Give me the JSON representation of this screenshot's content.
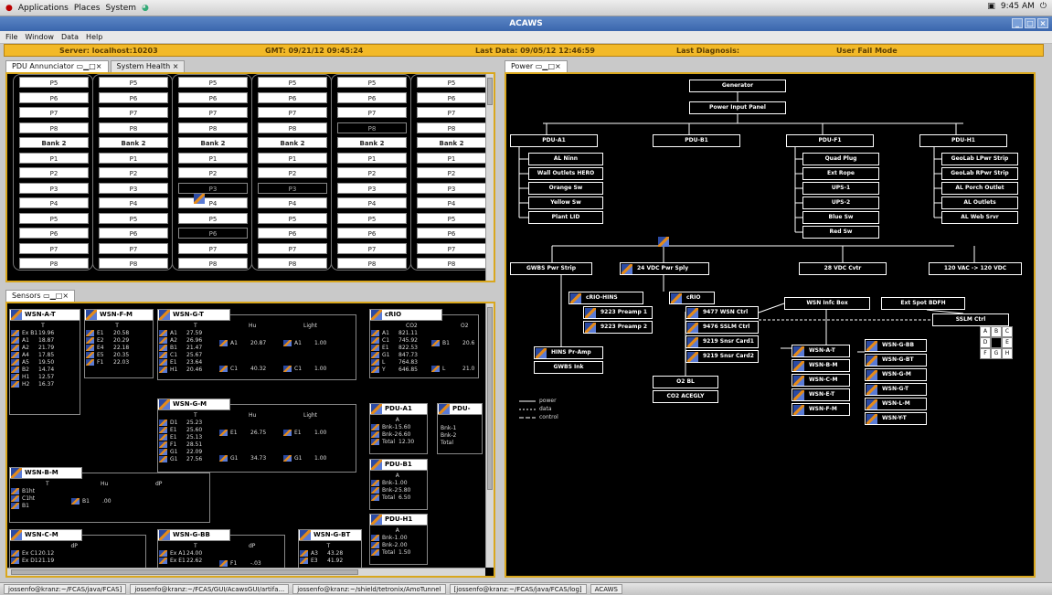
{
  "topbar": {
    "menus": [
      "Applications",
      "Places",
      "System"
    ],
    "time": "9:45 AM"
  },
  "window": {
    "title": "ACAWS"
  },
  "menubar": [
    "File",
    "Window",
    "Data",
    "Help"
  ],
  "status": {
    "server": "Server: localhost:10203",
    "gmt": "GMT: 09/21/12 09:45:24",
    "last_data": "Last Data: 09/05/12 12:46:59",
    "last_diag": "Last Diagnosis:",
    "mode": "User Fail Mode"
  },
  "tabs": {
    "pdu": "PDU Annunciator",
    "health": "System Health",
    "sensors": "Sensors",
    "power": "Power"
  },
  "pdu_columns": [
    [
      "P5",
      "P6",
      "P7",
      "P8",
      "Bank 2",
      "P1",
      "P2",
      "P3",
      "P4",
      "P5",
      "P6",
      "P7",
      "P8"
    ],
    [
      "P5",
      "P6",
      "P7",
      "P8",
      "Bank 2",
      "P1",
      "P2",
      "P3",
      "P4",
      "P5",
      "P6",
      "P7",
      "P8"
    ],
    [
      "P5",
      "P6",
      "P7",
      "P8",
      "Bank 2",
      "P1",
      "P2",
      "P3",
      "P4",
      "P5",
      "P6",
      "P7",
      "P8"
    ],
    [
      "P5",
      "P6",
      "P7",
      "P8",
      "Bank 2",
      "P1",
      "P2",
      "P3",
      "P4",
      "P5",
      "P6",
      "P7",
      "P8"
    ],
    [
      "P5",
      "P6",
      "P7",
      "P8",
      "Bank 2",
      "P1",
      "P2",
      "P3",
      "P4",
      "P5",
      "P6",
      "P7",
      "P8"
    ],
    [
      "P5",
      "P6",
      "P7",
      "P8",
      "Bank 2",
      "P1",
      "P2",
      "P3",
      "P4",
      "P5",
      "P6",
      "P7",
      "P8"
    ]
  ],
  "sensors": {
    "wsn_a_t": {
      "title": "WSN-A-T",
      "col": "T",
      "rows": [
        [
          "Ex B1",
          "19.96"
        ],
        [
          "A1",
          "18.87"
        ],
        [
          "A2",
          "21.79"
        ],
        [
          "A4",
          "17.85"
        ],
        [
          "A5",
          "19.50"
        ],
        [
          "B2",
          "14.74"
        ],
        [
          "H1",
          "12.57"
        ],
        [
          "H2",
          "16.37"
        ]
      ]
    },
    "wsn_f_m": {
      "title": "WSN-F-M",
      "col": "T",
      "rows": [
        [
          "E1",
          "20.58"
        ],
        [
          "E2",
          "20.29"
        ],
        [
          "E4",
          "22.18"
        ],
        [
          "E5",
          "20.35"
        ],
        [
          "F1",
          "22.03"
        ]
      ]
    },
    "wsn_g_t": {
      "title": "WSN-G-T",
      "cols": [
        "T",
        "Hu",
        "Light"
      ],
      "rows": [
        [
          "A1",
          "27.59"
        ],
        [
          "A2",
          "26.96"
        ],
        [
          "B1",
          "21.47"
        ],
        [
          "C1",
          "25.67"
        ],
        [
          "E1",
          "23.64"
        ],
        [
          "H1",
          "20.46"
        ]
      ],
      "hu": [
        [
          "A1",
          "20.87"
        ],
        [
          "C1",
          "40.32"
        ]
      ],
      "light": [
        [
          "A1",
          "1.00"
        ],
        [
          "C1",
          "1.00"
        ]
      ]
    },
    "crio": {
      "title": "cRIO",
      "cols": [
        "CO2",
        "O2"
      ],
      "rows": [
        [
          "A1",
          "821.11"
        ],
        [
          "C1",
          "745.92"
        ],
        [
          "E1",
          "822.53"
        ],
        [
          "G1",
          "847.73"
        ],
        [
          "L",
          "764.83"
        ],
        [
          "Y",
          "646.85"
        ]
      ],
      "o2": [
        [
          "B1",
          "20.6"
        ],
        [
          "L",
          "21.0"
        ]
      ]
    },
    "wsn_g_m": {
      "title": "WSN-G-M",
      "cols": [
        "T",
        "Hu",
        "Light"
      ],
      "rows": [
        [
          "D1",
          "25.23"
        ],
        [
          "E1",
          "25.60"
        ],
        [
          "E1",
          "25.13"
        ],
        [
          "F1",
          "28.51"
        ],
        [
          "G1",
          "22.09"
        ],
        [
          "G1",
          "27.56"
        ]
      ],
      "hu": [
        [
          "E1",
          "26.75"
        ],
        [
          "G1",
          "34.73"
        ]
      ],
      "light": [
        [
          "E1",
          "1.00"
        ],
        [
          "G1",
          "1.00"
        ]
      ]
    },
    "wsn_b_m": {
      "title": "WSN-B-M",
      "cols": [
        "T",
        "Hu",
        "dP"
      ],
      "rows": [
        [
          "B1ht",
          ""
        ],
        [
          "C1ht",
          ""
        ],
        [
          "B1",
          ""
        ]
      ],
      "dp": [
        [
          "B1",
          ".00"
        ]
      ]
    },
    "wsn_c_m": {
      "title": "WSN-C-M",
      "col": "dP",
      "rows": [
        [
          "Ex C1",
          "20.12"
        ],
        [
          "Ex D1",
          "21.19"
        ]
      ]
    },
    "wsn_g_bb": {
      "title": "WSN-G-BB",
      "cols": [
        "T",
        "dP"
      ],
      "rows": [
        [
          "Ex A1",
          "24.00"
        ],
        [
          "Ex E1",
          "22.62"
        ]
      ],
      "dp": [
        [
          "F1",
          "-.03"
        ]
      ]
    },
    "wsn_g_bt": {
      "title": "WSN-G-BT",
      "col": "T",
      "rows": [
        [
          "A3",
          "43.28"
        ],
        [
          "E3",
          "41.92"
        ]
      ]
    },
    "pdu_a1": {
      "title": "PDU-A1",
      "col": "A",
      "rows": [
        [
          "Bnk-1",
          "5.60"
        ],
        [
          "Bnk-2",
          "6.60"
        ],
        [
          "Total",
          "12.30"
        ]
      ]
    },
    "pdu_b1": {
      "title": "PDU-B1",
      "col": "A",
      "rows": [
        [
          "Bnk-1",
          ".00"
        ],
        [
          "Bnk-2",
          "5.80"
        ],
        [
          "Total",
          "6.50"
        ]
      ]
    },
    "pdu_h1": {
      "title": "PDU-H1",
      "col": "A",
      "rows": [
        [
          "Bnk-1",
          ".00"
        ],
        [
          "Bnk-2",
          ".00"
        ],
        [
          "Total",
          "1.50"
        ]
      ]
    },
    "pdu_e_cut": {
      "title": "PDU-",
      "rows": [
        "Bnk-1",
        "Bnk-2",
        "Total"
      ]
    }
  },
  "power": {
    "generator": "Generator",
    "input_panel": "Power Input Panel",
    "pdus": [
      "PDU-A1",
      "PDU-B1",
      "PDU-F1",
      "PDU-H1"
    ],
    "a1_loads": [
      "AL Ninn",
      "Wall Outlets HERO",
      "Orange Sw",
      "Yellow Sw",
      "Plant LID"
    ],
    "f1_loads": [
      "Quad Plug",
      "Ext Rope",
      "UPS-1",
      "UPS-2",
      "Blue Sw",
      "Red Sw"
    ],
    "h1_loads": [
      "GeoLab LPwr Strip",
      "GeoLab RPwr Strip",
      "AL Porch Outlet",
      "AL Outlets",
      "AL Web Srvr"
    ],
    "mid": [
      "GWBS Pwr Strip",
      "24 VDC Pwr Sply",
      "28 VDC Cvtr",
      "120 VAC -> 120 VDC"
    ],
    "crio_hins": "cRIO-HINS",
    "crio": "cRIO",
    "preamps": [
      "9223 Preamp 1",
      "9223 Preamp 2"
    ],
    "crio_mods": [
      "9477 WSN Ctrl",
      "9476 SSLM Ctrl",
      "9219 Snsr Card1",
      "9219 Snsr Card2"
    ],
    "misc": [
      "HINS Pr-Amp",
      "GWBS Ink",
      "O2 BL",
      "CO2 ACEGLY",
      "WSN Infc Box",
      "Ext Spot BDFH",
      "SSLM Ctrl"
    ],
    "wsn_left": [
      "WSN-A-T",
      "WSN-B-M",
      "WSN-C-M",
      "WSN-E-T",
      "WSN-F-M"
    ],
    "wsn_right": [
      "WSN-G-BB",
      "WSN-G-BT",
      "WSN-G-M",
      "WSN-G-T",
      "WSN-L-M",
      "WSN-Y-T"
    ],
    "legend": [
      "power",
      "data",
      "control"
    ],
    "grid": [
      "A",
      "B",
      "C",
      "D",
      "",
      "E",
      "F",
      "G",
      "H"
    ]
  },
  "taskbar": [
    "jossenfo@kranz:~/FCAS/java/FCAS]",
    "jossenfo@kranz:~/FCAS/GUI/AcawsGUI/artifa...",
    "jossenfo@kranz:~/shield/tetronix/AmoTunnel",
    "[jossenfo@kranz:~/FCAS/java/FCAS/log]",
    "ACAWS"
  ]
}
